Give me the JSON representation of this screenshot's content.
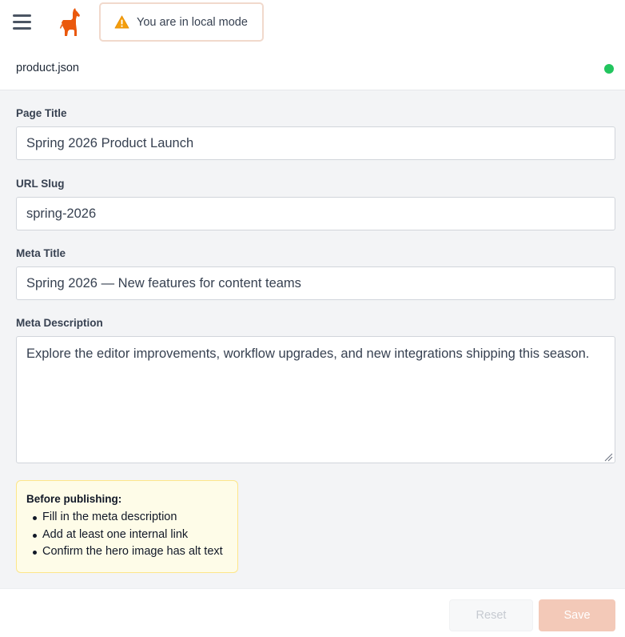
{
  "header": {
    "menu_icon": "hamburger-menu-icon",
    "logo_icon": "llama-logo-icon",
    "mode_badge": {
      "icon": "warning-triangle-icon",
      "text": "You are in local mode"
    }
  },
  "file": {
    "name": "product.json",
    "status_color": "#22c55e"
  },
  "form": {
    "page_title": {
      "label": "Page Title",
      "value": "Spring 2026 Product Launch"
    },
    "url_slug": {
      "label": "URL Slug",
      "value": "spring-2026"
    },
    "meta_title": {
      "label": "Meta Title",
      "value": "Spring 2026 — New features for content teams"
    },
    "meta_description": {
      "label": "Meta Description",
      "value": "Explore the editor improvements, workflow upgrades, and new integrations shipping this season."
    }
  },
  "notice": {
    "title": "Before publishing:",
    "items": [
      "Fill in the meta description",
      "Add at least one internal link",
      "Confirm the hero image has alt text"
    ]
  },
  "footer": {
    "reset_label": "Reset",
    "save_label": "Save"
  },
  "colors": {
    "accent": "#ea580c",
    "save_disabled_bg": "#f3c9b8",
    "notice_bg": "#fefce8",
    "notice_border": "#fde68a"
  }
}
